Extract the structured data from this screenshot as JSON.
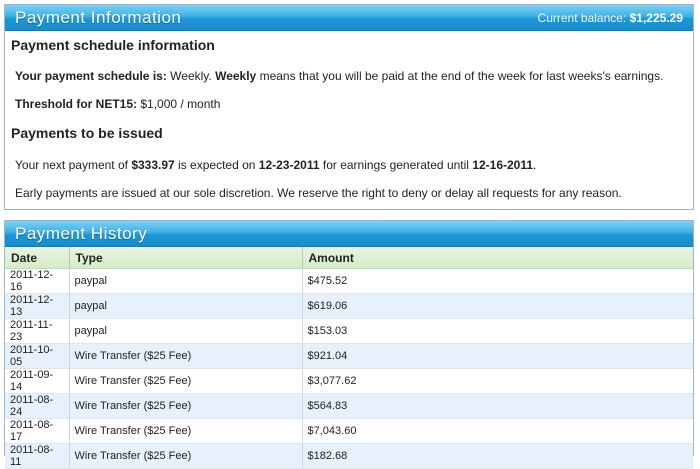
{
  "payment_info": {
    "title": "Payment Information",
    "balance_label": "Current balance:",
    "balance_value": "$1,225.29",
    "schedule_heading": "Payment schedule information",
    "schedule_label": "Your payment schedule is:",
    "schedule_value": "Weekly.",
    "schedule_desc_bold": "Weekly",
    "schedule_desc": "means that you will be paid at the end of the week for last weeks's earnings.",
    "threshold_label": "Threshold for NET15:",
    "threshold_value": "$1,000 / month",
    "issued_heading": "Payments to be issued",
    "next_payment_pre": "Your next payment of",
    "next_payment_amount": "$333.97",
    "next_payment_mid": "is expected on",
    "next_payment_date": "12-23-2011",
    "next_payment_mid2": "for earnings generated until",
    "next_payment_until": "12-16-2011",
    "next_payment_post": ".",
    "early_note": "Early payments are issued at our sole discretion. We reserve the right to deny or delay all requests for any reason."
  },
  "payment_history": {
    "title": "Payment History",
    "columns": [
      "Date",
      "Type",
      "Amount"
    ],
    "rows": [
      {
        "date": "2011-12-16",
        "type": "paypal",
        "amount": "$475.52"
      },
      {
        "date": "2011-12-13",
        "type": "paypal",
        "amount": "$619.06"
      },
      {
        "date": "2011-11-23",
        "type": "paypal",
        "amount": "$153.03"
      },
      {
        "date": "2011-10-05",
        "type": "Wire Transfer ($25 Fee)",
        "amount": "$921.04"
      },
      {
        "date": "2011-09-14",
        "type": "Wire Transfer ($25 Fee)",
        "amount": "$3,077.62"
      },
      {
        "date": "2011-08-24",
        "type": "Wire Transfer ($25 Fee)",
        "amount": "$564.83"
      },
      {
        "date": "2011-08-17",
        "type": "Wire Transfer ($25 Fee)",
        "amount": "$7,043.60"
      },
      {
        "date": "2011-08-11",
        "type": "Wire Transfer ($25 Fee)",
        "amount": "$182.68"
      }
    ]
  },
  "colors": {
    "header_blue": "#1e97d6",
    "table_header_green": "#dff0d8",
    "row_alt_blue": "#e6f1fb"
  }
}
